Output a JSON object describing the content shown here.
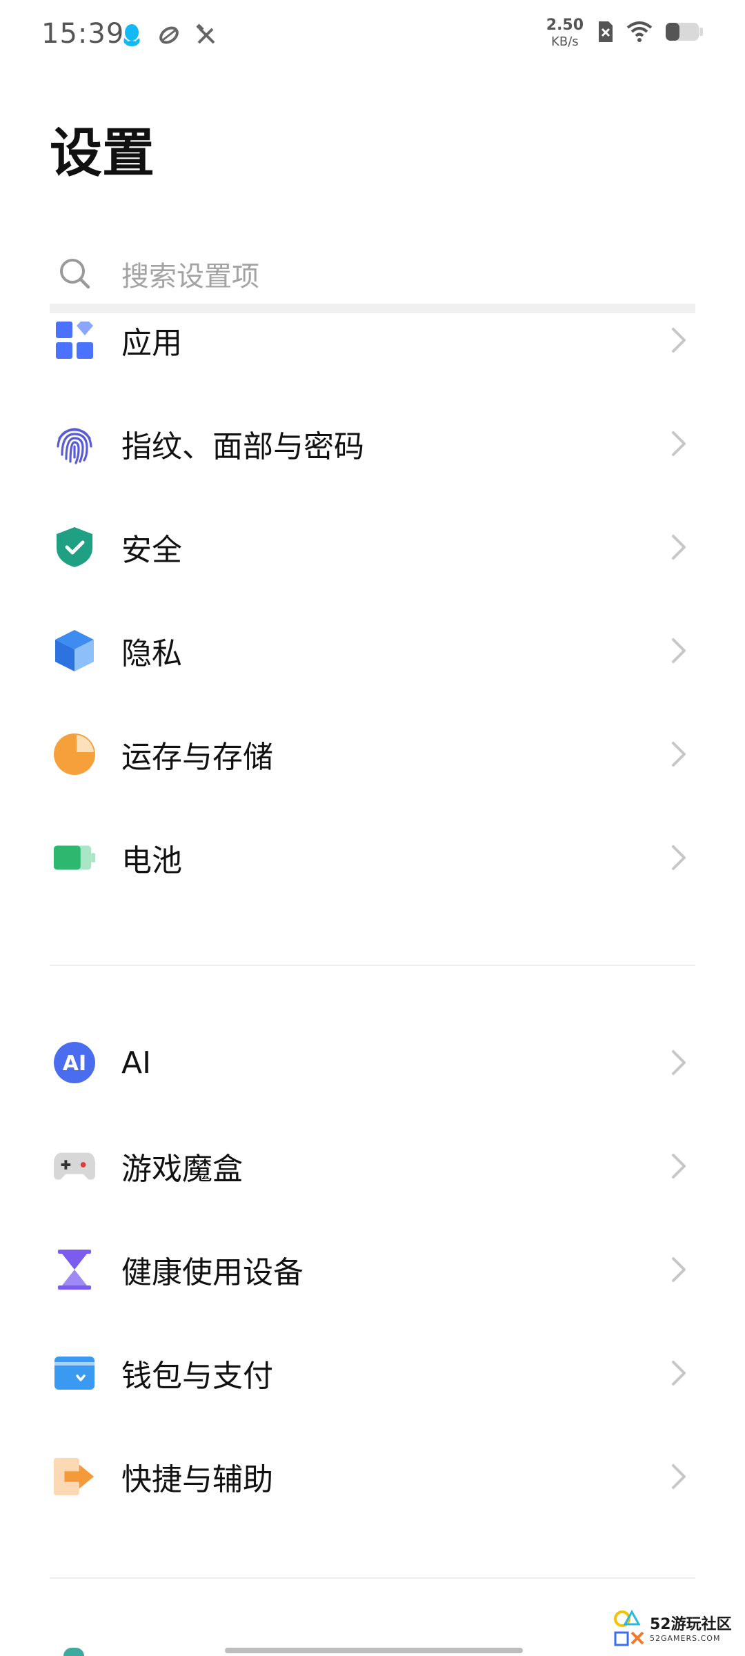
{
  "status_bar": {
    "time": "15:39",
    "net_speed_value": "2.50",
    "net_speed_unit": "KB/s",
    "left_icons": [
      "qq-icon",
      "sync-icon",
      "tools-icon"
    ],
    "right_icons": [
      "sim-disabled-icon",
      "wifi-icon",
      "battery-icon"
    ]
  },
  "header": {
    "title": "设置"
  },
  "search": {
    "placeholder": "搜索设置项"
  },
  "groups": [
    {
      "items": [
        {
          "label": "应用",
          "icon": "apps-icon",
          "color": "#4a72ff"
        },
        {
          "label": "指纹、面部与密码",
          "icon": "fingerprint-icon",
          "color": "#5a5bd6"
        },
        {
          "label": "安全",
          "icon": "shield-icon",
          "color": "#1fa083"
        },
        {
          "label": "隐私",
          "icon": "privacy-cube-icon",
          "color": "#3f8cf0"
        },
        {
          "label": "运存与存储",
          "icon": "storage-pie-icon",
          "color": "#f5a03a"
        },
        {
          "label": "电池",
          "icon": "battery-setting-icon",
          "color": "#2eb76e"
        }
      ]
    },
    {
      "items": [
        {
          "label": "AI",
          "icon": "ai-icon",
          "color": "#4a6df0"
        },
        {
          "label": "游戏魔盒",
          "icon": "gamepad-icon",
          "color": "#9a9a9a"
        },
        {
          "label": "健康使用设备",
          "icon": "hourglass-icon",
          "color": "#7a5cf0"
        },
        {
          "label": "钱包与支付",
          "icon": "wallet-icon",
          "color": "#3a9af2"
        },
        {
          "label": "快捷与辅助",
          "icon": "shortcut-icon",
          "color": "#f59a3a"
        }
      ]
    }
  ],
  "watermark": {
    "text": "52游玩社区",
    "sub": "52GAMERS.COM"
  }
}
